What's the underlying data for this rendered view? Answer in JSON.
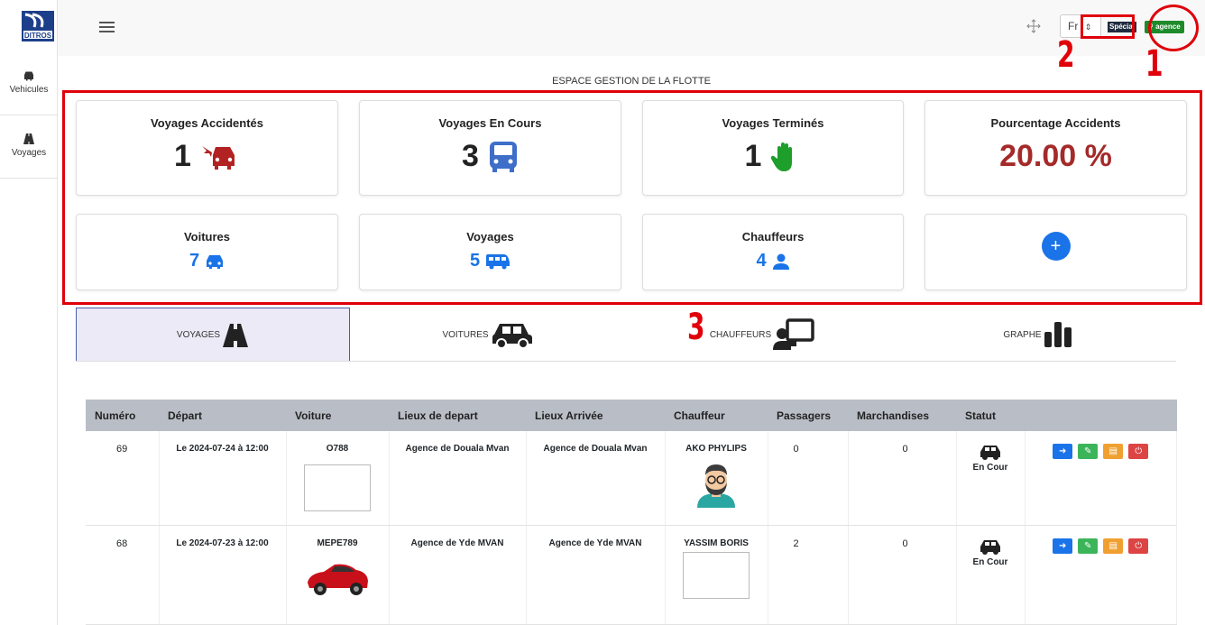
{
  "sidebar": {
    "items": [
      {
        "label": "Vehicules"
      },
      {
        "label": "Voyages"
      }
    ]
  },
  "header": {
    "lang": "Fr",
    "special": "Spécial",
    "agence": "agence"
  },
  "annotations": [
    "1",
    "2",
    "3"
  ],
  "page_title": "ESPACE GESTION DE LA FLOTTE",
  "stats": {
    "accidents": {
      "title": "Voyages Accidentés",
      "value": "1"
    },
    "en_cours": {
      "title": "Voyages En Cours",
      "value": "3"
    },
    "termines": {
      "title": "Voyages Terminés",
      "value": "1"
    },
    "pourcentage": {
      "title": "Pourcentage Accidents",
      "value": "20.00 %"
    },
    "voitures": {
      "title": "Voitures",
      "value": "7"
    },
    "voyages": {
      "title": "Voyages",
      "value": "5"
    },
    "chauffeurs": {
      "title": "Chauffeurs",
      "value": "4"
    },
    "add": "+"
  },
  "tabs": [
    {
      "label": "VOYAGES"
    },
    {
      "label": "VOITURES"
    },
    {
      "label": "CHAUFFEURS"
    },
    {
      "label": "GRAPHE"
    }
  ],
  "table": {
    "headers": [
      "Numéro",
      "Départ",
      "Voiture",
      "Lieux de depart",
      "Lieux Arrivée",
      "Chauffeur",
      "Passagers",
      "Marchandises",
      "Statut",
      ""
    ],
    "rows": [
      {
        "numero": "69",
        "depart": "Le 2024-07-24 à 12:00",
        "voiture": "O788",
        "lieu_depart": "Agence de Douala Mvan",
        "lieu_arrivee": "Agence de Douala Mvan",
        "chauffeur": "AKO PHYLIPS",
        "passagers": "0",
        "marchandises": "0",
        "statut": "En Cour"
      },
      {
        "numero": "68",
        "depart": "Le 2024-07-23 à 12:00",
        "voiture": "MEPE789",
        "lieu_depart": "Agence de Yde MVAN",
        "lieu_arrivee": "Agence de Yde MVAN",
        "chauffeur": "YASSIM BORIS",
        "passagers": "2",
        "marchandises": "0",
        "statut": "En Cour"
      }
    ]
  },
  "colors": {
    "accent": "#1a73e8",
    "danger": "#a52a2a",
    "annotation": "#e0000a"
  }
}
